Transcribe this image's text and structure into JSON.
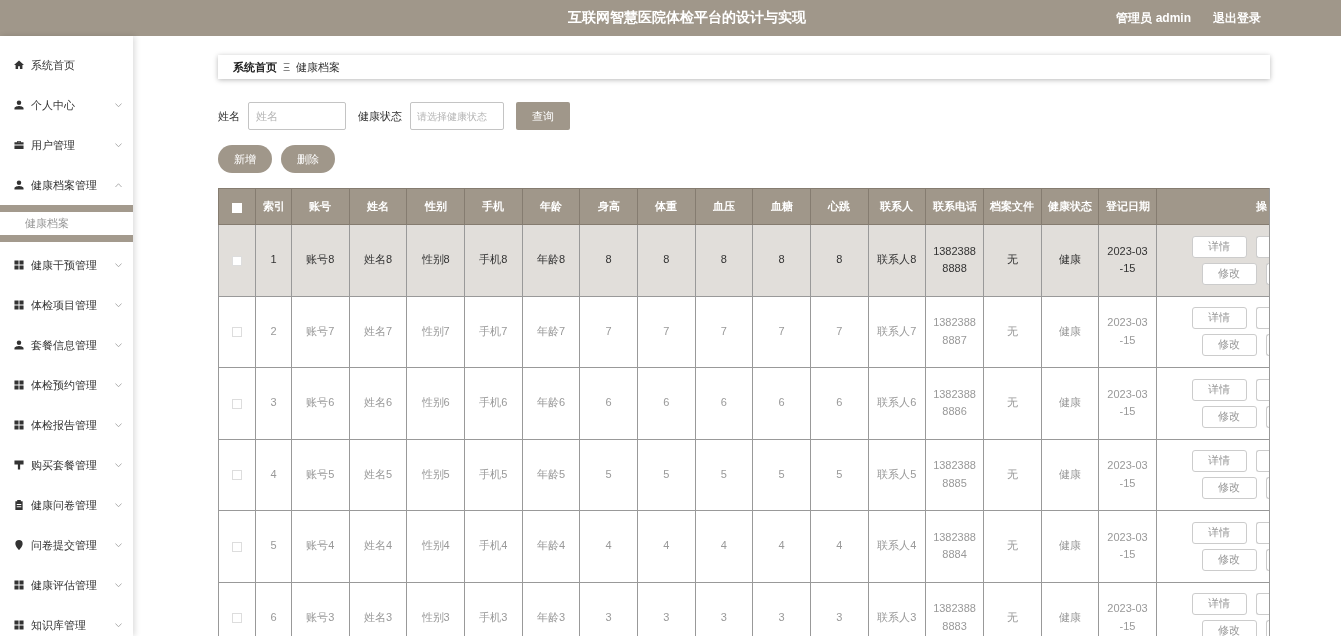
{
  "header": {
    "title": "互联网智慧医院体检平台的设计与实现",
    "user": "管理员 admin",
    "logout": "退出登录"
  },
  "sidebar": {
    "items": [
      {
        "kind": "link",
        "label": "系统首页"
      },
      {
        "kind": "menu",
        "label": "个人中心",
        "expanded": false
      },
      {
        "kind": "menu",
        "label": "用户管理",
        "expanded": false
      },
      {
        "kind": "menu",
        "label": "健康档案管理",
        "expanded": true,
        "children": [
          {
            "label": "健康档案",
            "selected": true
          }
        ]
      },
      {
        "kind": "menu",
        "label": "健康干预管理",
        "expanded": false
      },
      {
        "kind": "menu",
        "label": "体检项目管理",
        "expanded": false
      },
      {
        "kind": "menu",
        "label": "套餐信息管理",
        "expanded": false
      },
      {
        "kind": "menu",
        "label": "体检预约管理",
        "expanded": false
      },
      {
        "kind": "menu",
        "label": "体检报告管理",
        "expanded": false
      },
      {
        "kind": "menu",
        "label": "购买套餐管理",
        "expanded": false
      },
      {
        "kind": "menu",
        "label": "健康问卷管理",
        "expanded": false
      },
      {
        "kind": "menu",
        "label": "问卷提交管理",
        "expanded": false
      },
      {
        "kind": "menu",
        "label": "健康评估管理",
        "expanded": false
      },
      {
        "kind": "menu",
        "label": "知识库管理",
        "expanded": false
      }
    ]
  },
  "breadcrumb": {
    "items": [
      "系统首页",
      "健康档案"
    ],
    "separator": "Ξ"
  },
  "search": {
    "fields": [
      {
        "kind": "text",
        "label": "姓名",
        "placeholder": "姓名"
      },
      {
        "kind": "select",
        "label": "健康状态",
        "placeholder": "请选择健康状态"
      }
    ],
    "button": "查询"
  },
  "actions": [
    "新增",
    "删除"
  ],
  "table": {
    "all_checked": false,
    "columns": [
      "索引",
      "账号",
      "姓名",
      "性别",
      "手机",
      "年龄",
      "身高",
      "体重",
      "血压",
      "血糖",
      "心跳",
      "联系人",
      "联系电话",
      "档案文件",
      "健康状态",
      "登记日期",
      "操"
    ],
    "rows": [
      {
        "checked": false,
        "highlighted": true,
        "cells": [
          "1",
          "账号8",
          "姓名8",
          "性别8",
          "手机8",
          "年龄8",
          "8",
          "8",
          "8",
          "8",
          "8",
          "联系人8",
          "13823888888",
          "无",
          "健康",
          "2023-03-15"
        ],
        "actions": [
          "详情",
          "修改"
        ]
      },
      {
        "checked": false,
        "highlighted": false,
        "cells": [
          "2",
          "账号7",
          "姓名7",
          "性别7",
          "手机7",
          "年龄7",
          "7",
          "7",
          "7",
          "7",
          "7",
          "联系人7",
          "13823888887",
          "无",
          "健康",
          "2023-03-15"
        ],
        "actions": [
          "详情",
          "修改"
        ]
      },
      {
        "checked": false,
        "highlighted": false,
        "cells": [
          "3",
          "账号6",
          "姓名6",
          "性别6",
          "手机6",
          "年龄6",
          "6",
          "6",
          "6",
          "6",
          "6",
          "联系人6",
          "13823888886",
          "无",
          "健康",
          "2023-03-15"
        ],
        "actions": [
          "详情",
          "修改"
        ]
      },
      {
        "checked": false,
        "highlighted": false,
        "cells": [
          "4",
          "账号5",
          "姓名5",
          "性别5",
          "手机5",
          "年龄5",
          "5",
          "5",
          "5",
          "5",
          "5",
          "联系人5",
          "13823888885",
          "无",
          "健康",
          "2023-03-15"
        ],
        "actions": [
          "详情",
          "修改"
        ]
      },
      {
        "checked": false,
        "highlighted": false,
        "cells": [
          "5",
          "账号4",
          "姓名4",
          "性别4",
          "手机4",
          "年龄4",
          "4",
          "4",
          "4",
          "4",
          "4",
          "联系人4",
          "13823888884",
          "无",
          "健康",
          "2023-03-15"
        ],
        "actions": [
          "详情",
          "修改"
        ]
      },
      {
        "checked": false,
        "highlighted": false,
        "cells": [
          "6",
          "账号3",
          "姓名3",
          "性别3",
          "手机3",
          "年龄3",
          "3",
          "3",
          "3",
          "3",
          "3",
          "联系人3",
          "13823888883",
          "无",
          "健康",
          "2023-03-15"
        ],
        "actions": [
          "详情",
          "修改"
        ]
      }
    ]
  }
}
